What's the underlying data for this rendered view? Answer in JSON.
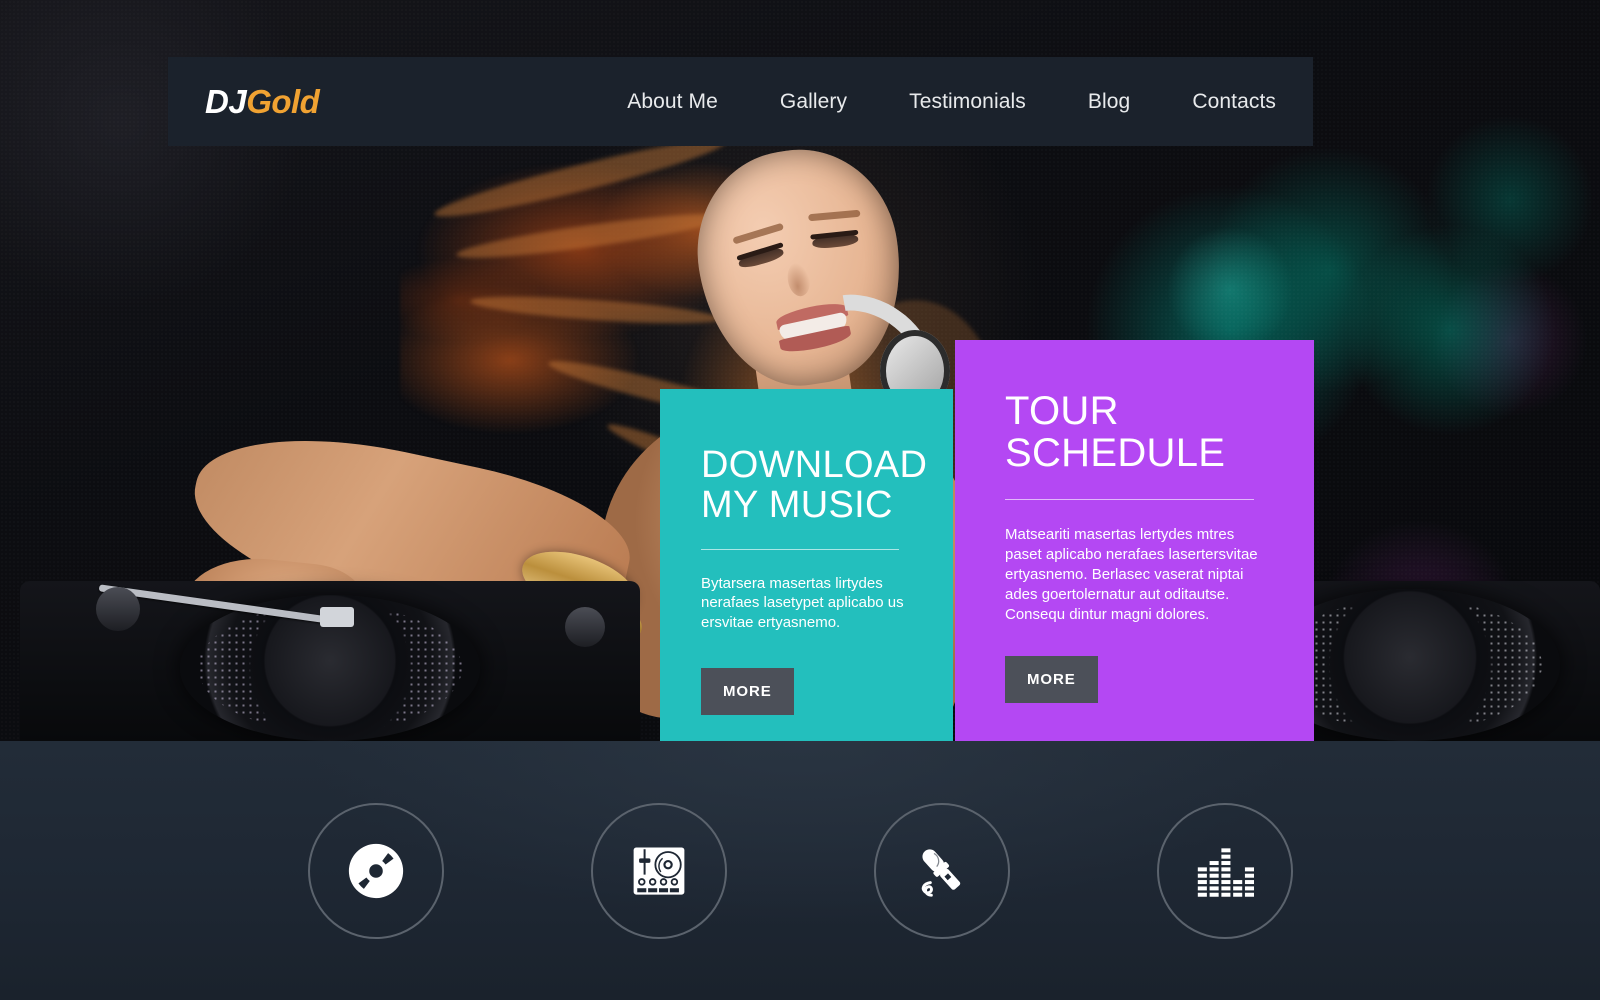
{
  "site": {
    "logo_primary": "DJ",
    "logo_accent": "Gold",
    "accent_purple": "#b44ae8",
    "accent_orange": "#f0a232",
    "header_bg": "#1b222c",
    "teal": "#23bfbd",
    "purple": "#b448f3",
    "button_bg": "#4c5059",
    "features_bg": "#1e2733"
  },
  "nav": {
    "items": [
      {
        "label": "About Me"
      },
      {
        "label": "Gallery"
      },
      {
        "label": "Testimonials"
      },
      {
        "label": "Blog"
      },
      {
        "label": "Contacts"
      }
    ]
  },
  "promos": {
    "music": {
      "title_line1": "DOWNLOAD",
      "title_line2": "MY MUSIC",
      "body": "Bytarsera masertas lirtydes nerafaes lasetypet aplicabo us ersvitae ertyasnemo.",
      "button_label": "MORE"
    },
    "tour": {
      "title_line1": "TOUR",
      "title_line2": "SCHEDULE",
      "body": "Matseariti masertas lertydes mtres paset aplicabo nerafaes lasertersvitae ertyasnemo. Berlasec vaserat niptai ades goertolernatur aut oditautse. Consequ dintur magni dolores.",
      "button_label": "MORE"
    }
  },
  "features": {
    "items": [
      {
        "icon": "vinyl-disc-icon"
      },
      {
        "icon": "turntable-mixer-icon"
      },
      {
        "icon": "microphone-icon"
      },
      {
        "icon": "equalizer-icon"
      }
    ]
  }
}
